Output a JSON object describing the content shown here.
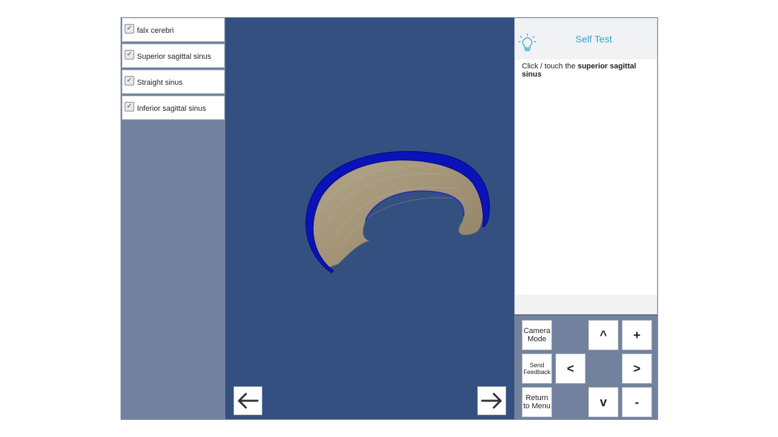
{
  "layers": [
    {
      "label": "falx cerebri",
      "checked": true
    },
    {
      "label": "Superior sagittal sinus",
      "checked": true
    },
    {
      "label": "Straight sinus",
      "checked": true
    },
    {
      "label": "Inferior sagittal sinus",
      "checked": true
    }
  ],
  "checkmark": "✓",
  "self_test": {
    "title": "Self Test",
    "icon": "lightbulb-icon",
    "prompt_prefix": "Click / touch the ",
    "prompt_target": "superior sagittal sinus"
  },
  "navigation": {
    "back_icon": "arrow-left-icon",
    "forward_icon": "arrow-right-icon"
  },
  "controls": {
    "camera_mode": "Camera Mode",
    "send_feedback": "Send Feedback",
    "return_to_menu": "Return to Menu",
    "up": "^",
    "down": "v",
    "left": "<",
    "right": ">",
    "zoom_in": "+",
    "zoom_out": "-"
  },
  "colors": {
    "viewport_bg": "#345080",
    "panel_bg": "#72829e",
    "accent": "#2fa4cf",
    "sinus_blue": "#0a12b8",
    "falx_tan": "#a39478"
  }
}
